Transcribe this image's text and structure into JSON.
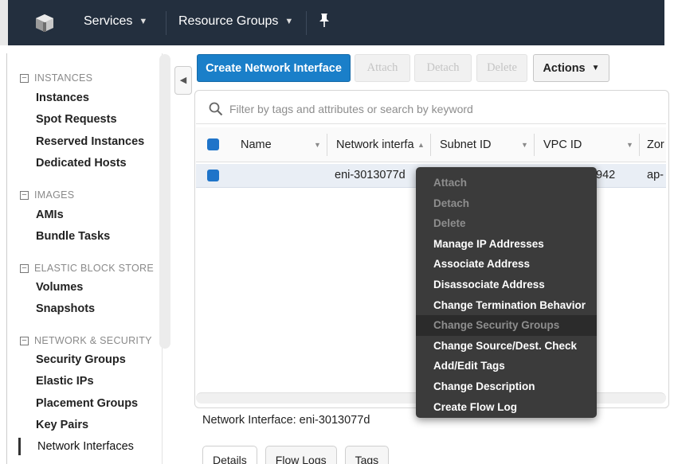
{
  "topbar": {
    "logo_icon": "aws-cube-icon",
    "services_label": "Services",
    "resource_groups_label": "Resource Groups",
    "pin_icon": "pin-icon"
  },
  "sidebar": {
    "sections": [
      {
        "heading": "INSTANCES",
        "items": [
          "Instances",
          "Spot Requests",
          "Reserved Instances",
          "Dedicated Hosts"
        ]
      },
      {
        "heading": "IMAGES",
        "items": [
          "AMIs",
          "Bundle Tasks"
        ]
      },
      {
        "heading": "ELASTIC BLOCK STORE",
        "items": [
          "Volumes",
          "Snapshots"
        ]
      },
      {
        "heading": "NETWORK & SECURITY",
        "items": [
          "Security Groups",
          "Elastic IPs",
          "Placement Groups",
          "Key Pairs",
          "Network Interfaces"
        ]
      }
    ],
    "active_item": "Network Interfaces"
  },
  "toolbar": {
    "create_label": "Create Network Interface",
    "attach_label": "Attach",
    "detach_label": "Detach",
    "delete_label": "Delete",
    "actions_label": "Actions"
  },
  "search": {
    "placeholder": "Filter by tags and attributes or search by keyword"
  },
  "table": {
    "columns": [
      "Name",
      "Network interfa",
      "Subnet ID",
      "VPC ID",
      "Zor"
    ],
    "rows": [
      {
        "name": "",
        "network_interface": "eni-3013077d",
        "vpc_id_fragment": "942",
        "zone_fragment": "ap-"
      }
    ]
  },
  "context_menu": {
    "items": [
      {
        "label": "Attach",
        "state": "disabled"
      },
      {
        "label": "Detach",
        "state": "disabled"
      },
      {
        "label": "Delete",
        "state": "disabled"
      },
      {
        "label": "Manage IP Addresses",
        "state": "enabled"
      },
      {
        "label": "Associate Address",
        "state": "enabled"
      },
      {
        "label": "Disassociate Address",
        "state": "enabled"
      },
      {
        "label": "Change Termination Behavior",
        "state": "enabled"
      },
      {
        "label": "Change Security Groups",
        "state": "hover"
      },
      {
        "label": "Change Source/Dest. Check",
        "state": "enabled"
      },
      {
        "label": "Add/Edit Tags",
        "state": "enabled"
      },
      {
        "label": "Change Description",
        "state": "enabled"
      },
      {
        "label": "Create Flow Log",
        "state": "enabled"
      }
    ]
  },
  "details": {
    "title": "Network Interface: eni-3013077d",
    "tabs": [
      "Details",
      "Flow Logs",
      "Tags"
    ]
  },
  "colors": {
    "topbar": "#232f3e",
    "primary": "#1a7fc9",
    "menu": "#3b3b3b"
  }
}
